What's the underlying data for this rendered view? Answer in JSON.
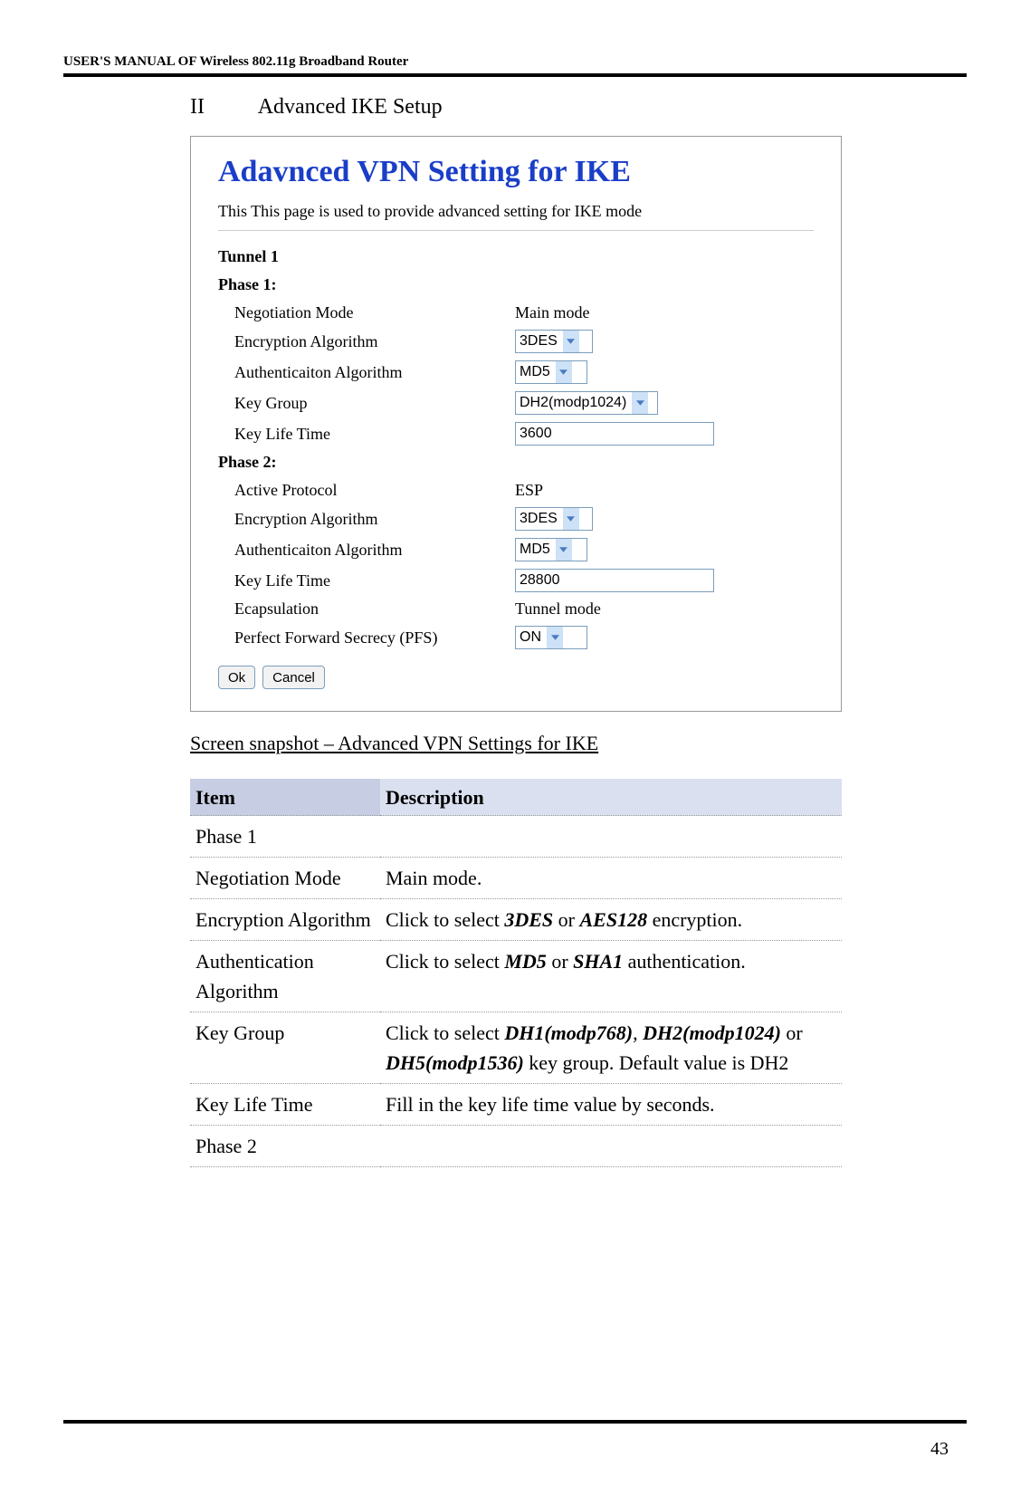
{
  "header": "USER'S MANUAL OF Wireless 802.11g Broadband Router",
  "section": {
    "roman": "II",
    "title": "Advanced IKE Setup"
  },
  "panel": {
    "title": "Adavnced VPN Setting for IKE",
    "desc": "This This page is used to provide advanced setting for IKE mode",
    "tunnel": "Tunnel 1",
    "phase1_label": "Phase 1:",
    "phase2_label": "Phase 2:",
    "p1": {
      "neg_label": "Negotiation Mode",
      "neg_value": "Main mode",
      "enc_label": "Encryption Algorithm",
      "enc_value": "3DES",
      "auth_label": "Authenticaiton Algorithm",
      "auth_value": "MD5",
      "key_group_label": "Key Group",
      "key_group_value": "DH2(modp1024)",
      "key_life_label": "Key Life Time",
      "key_life_value": "3600"
    },
    "p2": {
      "active_label": "Active Protocol",
      "active_value": "ESP",
      "enc_label": "Encryption Algorithm",
      "enc_value": "3DES",
      "auth_label": "Authenticaiton Algorithm",
      "auth_value": "MD5",
      "key_life_label": "Key Life Time",
      "key_life_value": "28800",
      "encap_label": "Ecapsulation",
      "encap_value": "Tunnel mode",
      "pfs_label": "Perfect Forward Secrecy (PFS)",
      "pfs_value": "ON"
    },
    "ok_btn": "Ok",
    "cancel_btn": "Cancel"
  },
  "caption": "Screen snapshot – Advanced VPN Settings for IKE",
  "table": {
    "header_item": "Item",
    "header_desc": "Description",
    "rows": {
      "r0_item": "Phase 1",
      "r0_desc": "",
      "r1_item": "Negotiation Mode",
      "r1_desc": "Main mode.",
      "r2_item": "Encryption Algorithm",
      "r2_desc_pre": "Click to select ",
      "r2_b1": "3DES",
      "r2_mid": " or ",
      "r2_b2": "AES128",
      "r2_post": " encryption.",
      "r3_item": "Authentication Algorithm",
      "r3_desc_pre": "Click to select ",
      "r3_b1": "MD5",
      "r3_mid": " or ",
      "r3_b2": "SHA1",
      "r3_post": " authentication.",
      "r4_item": "Key Group",
      "r4_desc_pre": "Click to select ",
      "r4_b1": "DH1(modp768)",
      "r4_sep1": ", ",
      "r4_b2": "DH2(modp1024)",
      "r4_sep2": " or ",
      "r4_b3": "DH5(modp1536)",
      "r4_post": " key group. Default value is DH2",
      "r5_item": "Key Life Time",
      "r5_desc": "Fill in the key life time value by seconds.",
      "r6_item": "Phase 2",
      "r6_desc": ""
    }
  },
  "page_number": "43"
}
